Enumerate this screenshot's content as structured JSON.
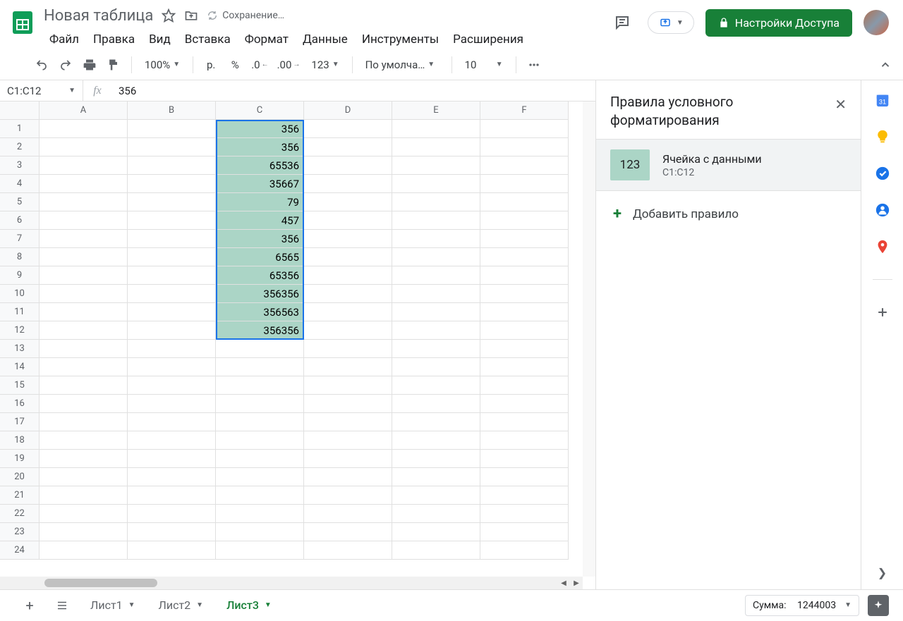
{
  "header": {
    "doc_title": "Новая таблица",
    "saving": "Сохранение…",
    "menu": [
      "Файл",
      "Правка",
      "Вид",
      "Вставка",
      "Формат",
      "Данные",
      "Инструменты",
      "Расширения"
    ],
    "share_label": "Настройки Доступа"
  },
  "toolbar": {
    "zoom": "100%",
    "currency": "р.",
    "percent": "%",
    "dec_dec": ".0",
    "inc_dec": ".00",
    "num_fmt": "123",
    "font": "По умолча…",
    "font_size": "10"
  },
  "name_box": "C1:C12",
  "formula": "356",
  "columns": [
    "A",
    "B",
    "C",
    "D",
    "E",
    "F"
  ],
  "row_count": 24,
  "cells_c": [
    "356",
    "356",
    "65536",
    "35667",
    "79",
    "457",
    "356",
    "6565",
    "65356",
    "356356",
    "356563",
    "356356"
  ],
  "sidebar": {
    "title": "Правила условного форматирования",
    "rule_swatch_text": "123",
    "rule_name": "Ячейка с данными",
    "rule_range": "C1:C12",
    "add_label": "Добавить правило"
  },
  "tabs": [
    "Лист1",
    "Лист2",
    "Лист3"
  ],
  "active_tab": 2,
  "status": {
    "label": "Сумма:",
    "value": "1244003"
  }
}
